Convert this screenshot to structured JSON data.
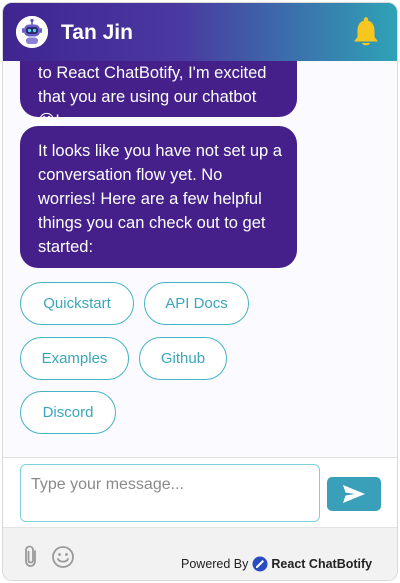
{
  "header": {
    "title": "Tan Jin",
    "avatar_icon": "robot-icon",
    "notification_icon": "bell-icon",
    "gradient": [
      "#3f2590",
      "#2ea3b6"
    ]
  },
  "messages": [
    {
      "lines": [
        "to React ChatBotify, I'm excited",
        "that you are using our chatbot 😊!"
      ]
    },
    {
      "lines": [
        "It looks like you have not set up a",
        "conversation flow yet. No",
        "worries! Here are a few helpful",
        "things you can check out to get",
        "started:"
      ]
    }
  ],
  "options": [
    "Quickstart",
    "API Docs",
    "Examples",
    "Github",
    "Discord"
  ],
  "input": {
    "placeholder": "Type your message...",
    "send_icon": "send-icon"
  },
  "footer": {
    "attach_icon": "paperclip-icon",
    "emoji_icon": "smiley-icon",
    "powered_by": "Powered By",
    "brand": "React ChatBotify"
  },
  "colors": {
    "bubble": "#45208a",
    "option_border": "#44b3c6",
    "send_button": "#3a9fb8",
    "bell": "#f7c71f"
  }
}
